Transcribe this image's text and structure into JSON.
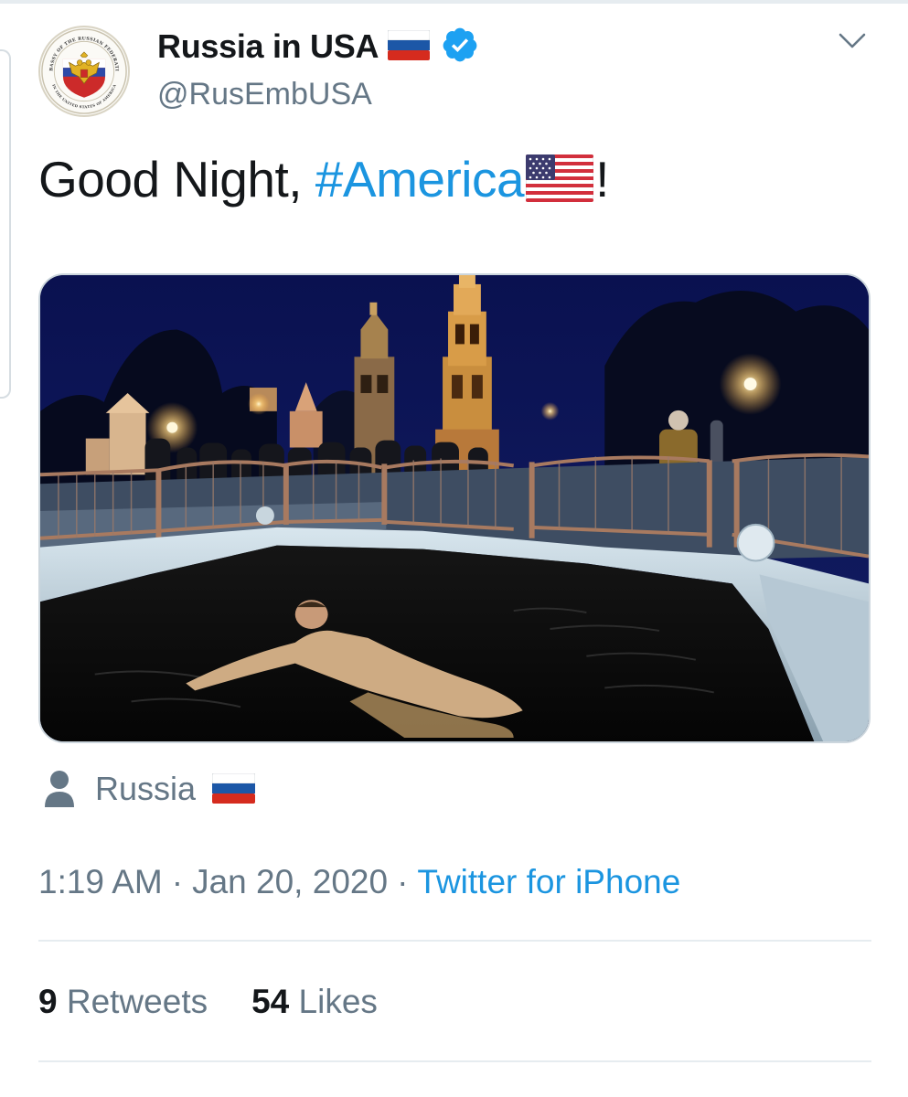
{
  "tweet": {
    "display_name": "Russia in USA",
    "handle": "@RusEmbUSA",
    "verified": true,
    "text_prefix": "Good Night, ",
    "hashtag": "#America",
    "text_suffix": "!",
    "location": "Russia",
    "time": "1:19 AM",
    "separator": "·",
    "date": "Jan 20, 2020",
    "source": "Twitter for iPhone",
    "retweets_count": "9",
    "retweets_label": "Retweets",
    "likes_count": "54",
    "likes_label": "Likes"
  },
  "icons": {
    "verified": "verified-badge-icon",
    "caret": "chevron-down-icon",
    "location": "person-icon",
    "flag_ru": "russia-flag-icon",
    "flag_us": "usa-flag-icon"
  },
  "avatar": {
    "seal_text_top": "EMBASSY OF THE RUSSIAN FEDERATION",
    "seal_text_bottom": "IN THE UNITED STATES OF AMERICA"
  },
  "colors": {
    "link_blue": "#1b95e0",
    "muted_gray": "#657786",
    "text_dark": "#14171a",
    "verified_blue": "#1da1f2"
  }
}
